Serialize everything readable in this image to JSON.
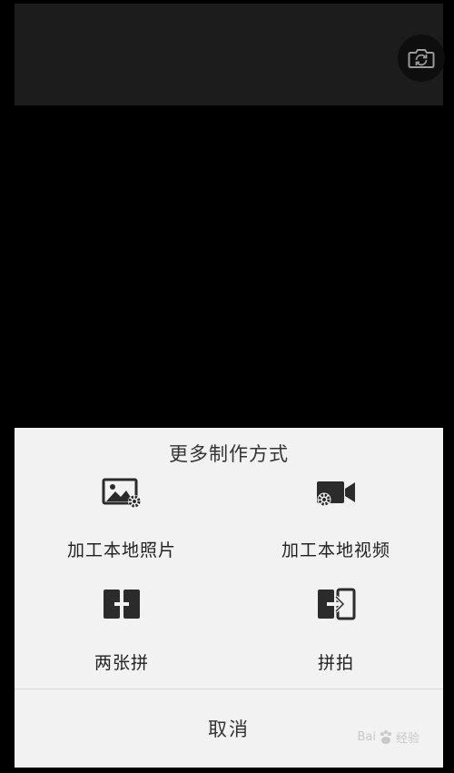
{
  "sheet": {
    "title": "更多制作方式",
    "options": [
      {
        "label": "加工本地照片",
        "icon": "photo-gear-icon"
      },
      {
        "label": "加工本地视频",
        "icon": "video-gear-icon"
      },
      {
        "label": "两张拼",
        "icon": "split-plus-icon"
      },
      {
        "label": "拼拍",
        "icon": "split-enter-icon"
      }
    ],
    "cancel_label": "取消"
  },
  "camera": {
    "switch_icon": "camera-switch-icon"
  },
  "watermark": {
    "text": "Bai",
    "text2": "经验",
    "icon": "baidu-paw-icon"
  }
}
